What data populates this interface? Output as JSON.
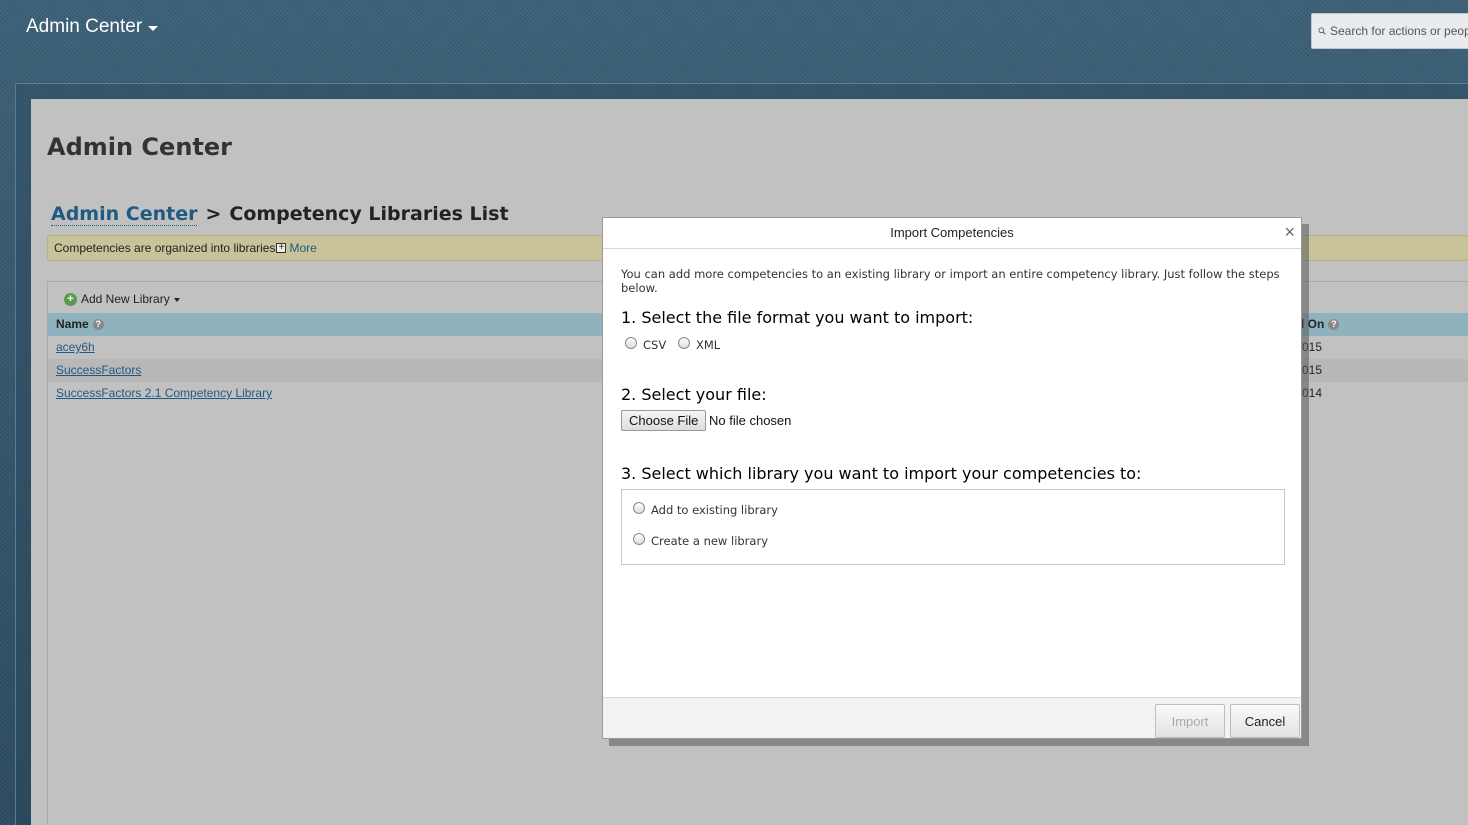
{
  "topbar": {
    "app_title": "Admin Center",
    "search_placeholder": "Search for actions or people"
  },
  "page": {
    "heading": "Admin Center",
    "breadcrumb": {
      "root": "Admin Center",
      "separator": ">",
      "current": "Competency Libraries List"
    },
    "info": {
      "text": "Competencies are organized into libraries",
      "more_label": "More"
    },
    "toolbar": {
      "add_new_library": "Add New Library"
    },
    "table": {
      "col_name": "Name",
      "col_date": "d On",
      "rows": [
        {
          "name": "acey6h",
          "date": "015"
        },
        {
          "name": "SuccessFactors",
          "date": "015"
        },
        {
          "name": "SuccessFactors 2.1 Competency Library",
          "date": "014"
        }
      ]
    }
  },
  "dialog": {
    "title": "Import Competencies",
    "close": "×",
    "intro": "You can add more competencies to an existing library or import an entire competency library. Just follow the steps below.",
    "step1": "1. Select the file format you want to import:",
    "format_csv": "CSV",
    "format_xml": "XML",
    "step2": "2. Select your file:",
    "choose_file": "Choose File",
    "no_file": "No file chosen",
    "step3": "3. Select which library you want to import your competencies to:",
    "option_existing": "Add to existing library",
    "option_new": "Create a new library",
    "import_label": "Import",
    "cancel_label": "Cancel"
  }
}
